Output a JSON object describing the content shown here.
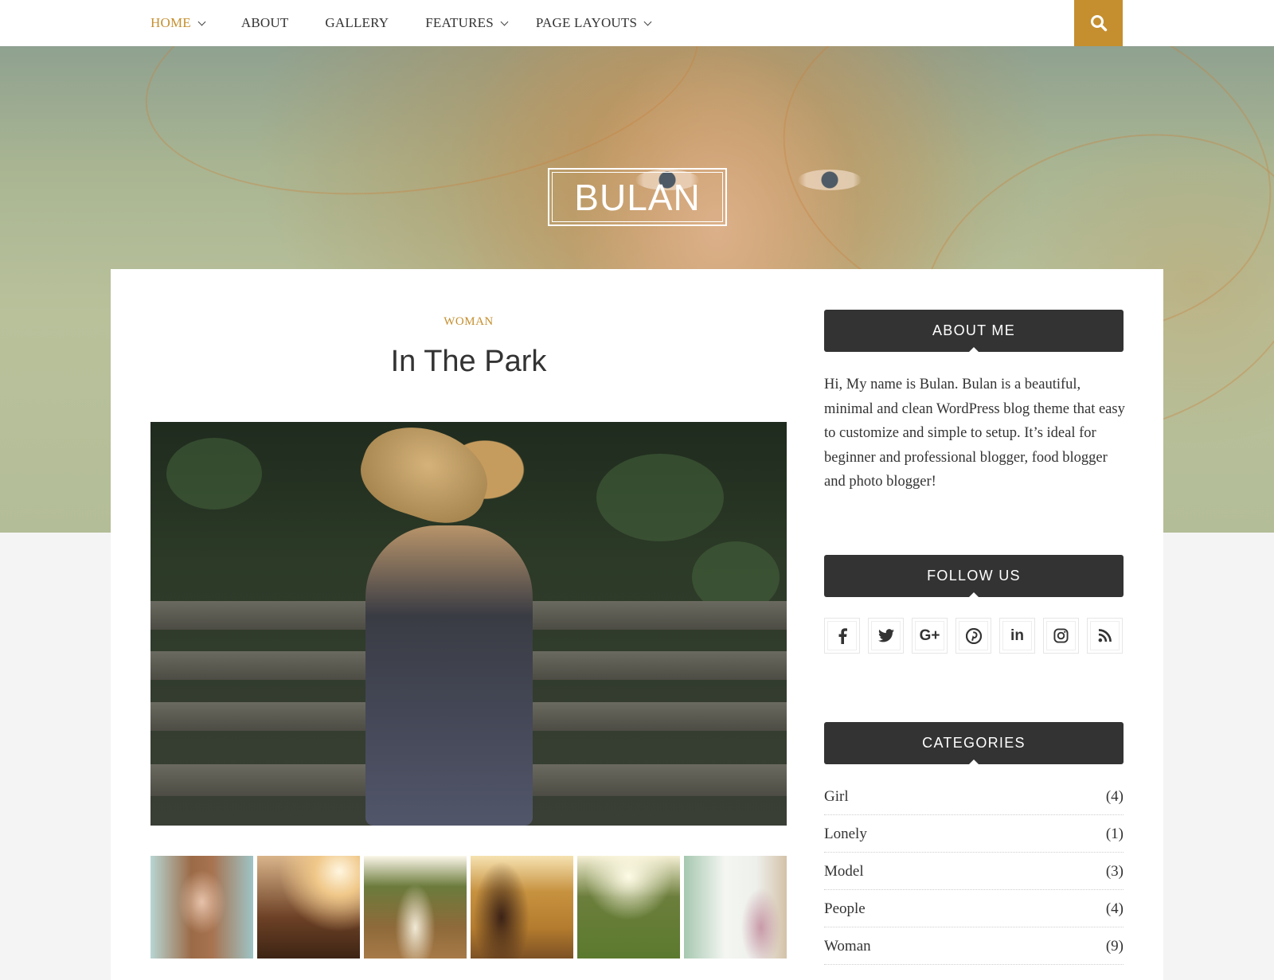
{
  "nav": {
    "items": [
      {
        "label": "HOME",
        "has_dropdown": true,
        "active": true
      },
      {
        "label": "ABOUT",
        "has_dropdown": false,
        "active": false
      },
      {
        "label": "GALLERY",
        "has_dropdown": false,
        "active": false
      },
      {
        "label": "FEATURES",
        "has_dropdown": true,
        "active": false
      },
      {
        "label": "PAGE LAYOUTS",
        "has_dropdown": true,
        "active": false
      }
    ],
    "search_icon": "search-icon"
  },
  "header": {
    "site_title": "BULAN"
  },
  "post": {
    "category": "WOMAN",
    "title": "In The Park",
    "featured_image": "woman-with-straw-hat-on-park-bench",
    "gallery_thumbnails": [
      "redhead-woman-portrait",
      "woman-backlit-sunset",
      "blonde-woman-in-field",
      "woman-golden-field",
      "woman-sunlit-meadow",
      "woman-with-hat-smiling"
    ]
  },
  "sidebar": {
    "about": {
      "title": "ABOUT ME",
      "text": "Hi, My name is Bulan. Bulan is a beautiful, minimal and clean WordPress blog theme that easy to customize and simple to setup. It’s ideal for beginner and professional blogger, food blogger and photo blogger!"
    },
    "follow": {
      "title": "FOLLOW US",
      "networks": [
        {
          "name": "facebook",
          "glyph": "f"
        },
        {
          "name": "twitter",
          "glyph": "t"
        },
        {
          "name": "google-plus",
          "glyph": "G+"
        },
        {
          "name": "pinterest",
          "glyph": "p"
        },
        {
          "name": "linkedin",
          "glyph": "in"
        },
        {
          "name": "instagram",
          "glyph": "ig"
        },
        {
          "name": "rss",
          "glyph": "rss"
        }
      ]
    },
    "categories": {
      "title": "CATEGORIES",
      "items": [
        {
          "name": "Girl",
          "count": "(4)"
        },
        {
          "name": "Lonely",
          "count": "(1)"
        },
        {
          "name": "Model",
          "count": "(3)"
        },
        {
          "name": "People",
          "count": "(4)"
        },
        {
          "name": "Woman",
          "count": "(9)"
        }
      ]
    }
  },
  "colors": {
    "accent": "#c58f2f",
    "widget_header": "#333333",
    "text": "#333333"
  }
}
